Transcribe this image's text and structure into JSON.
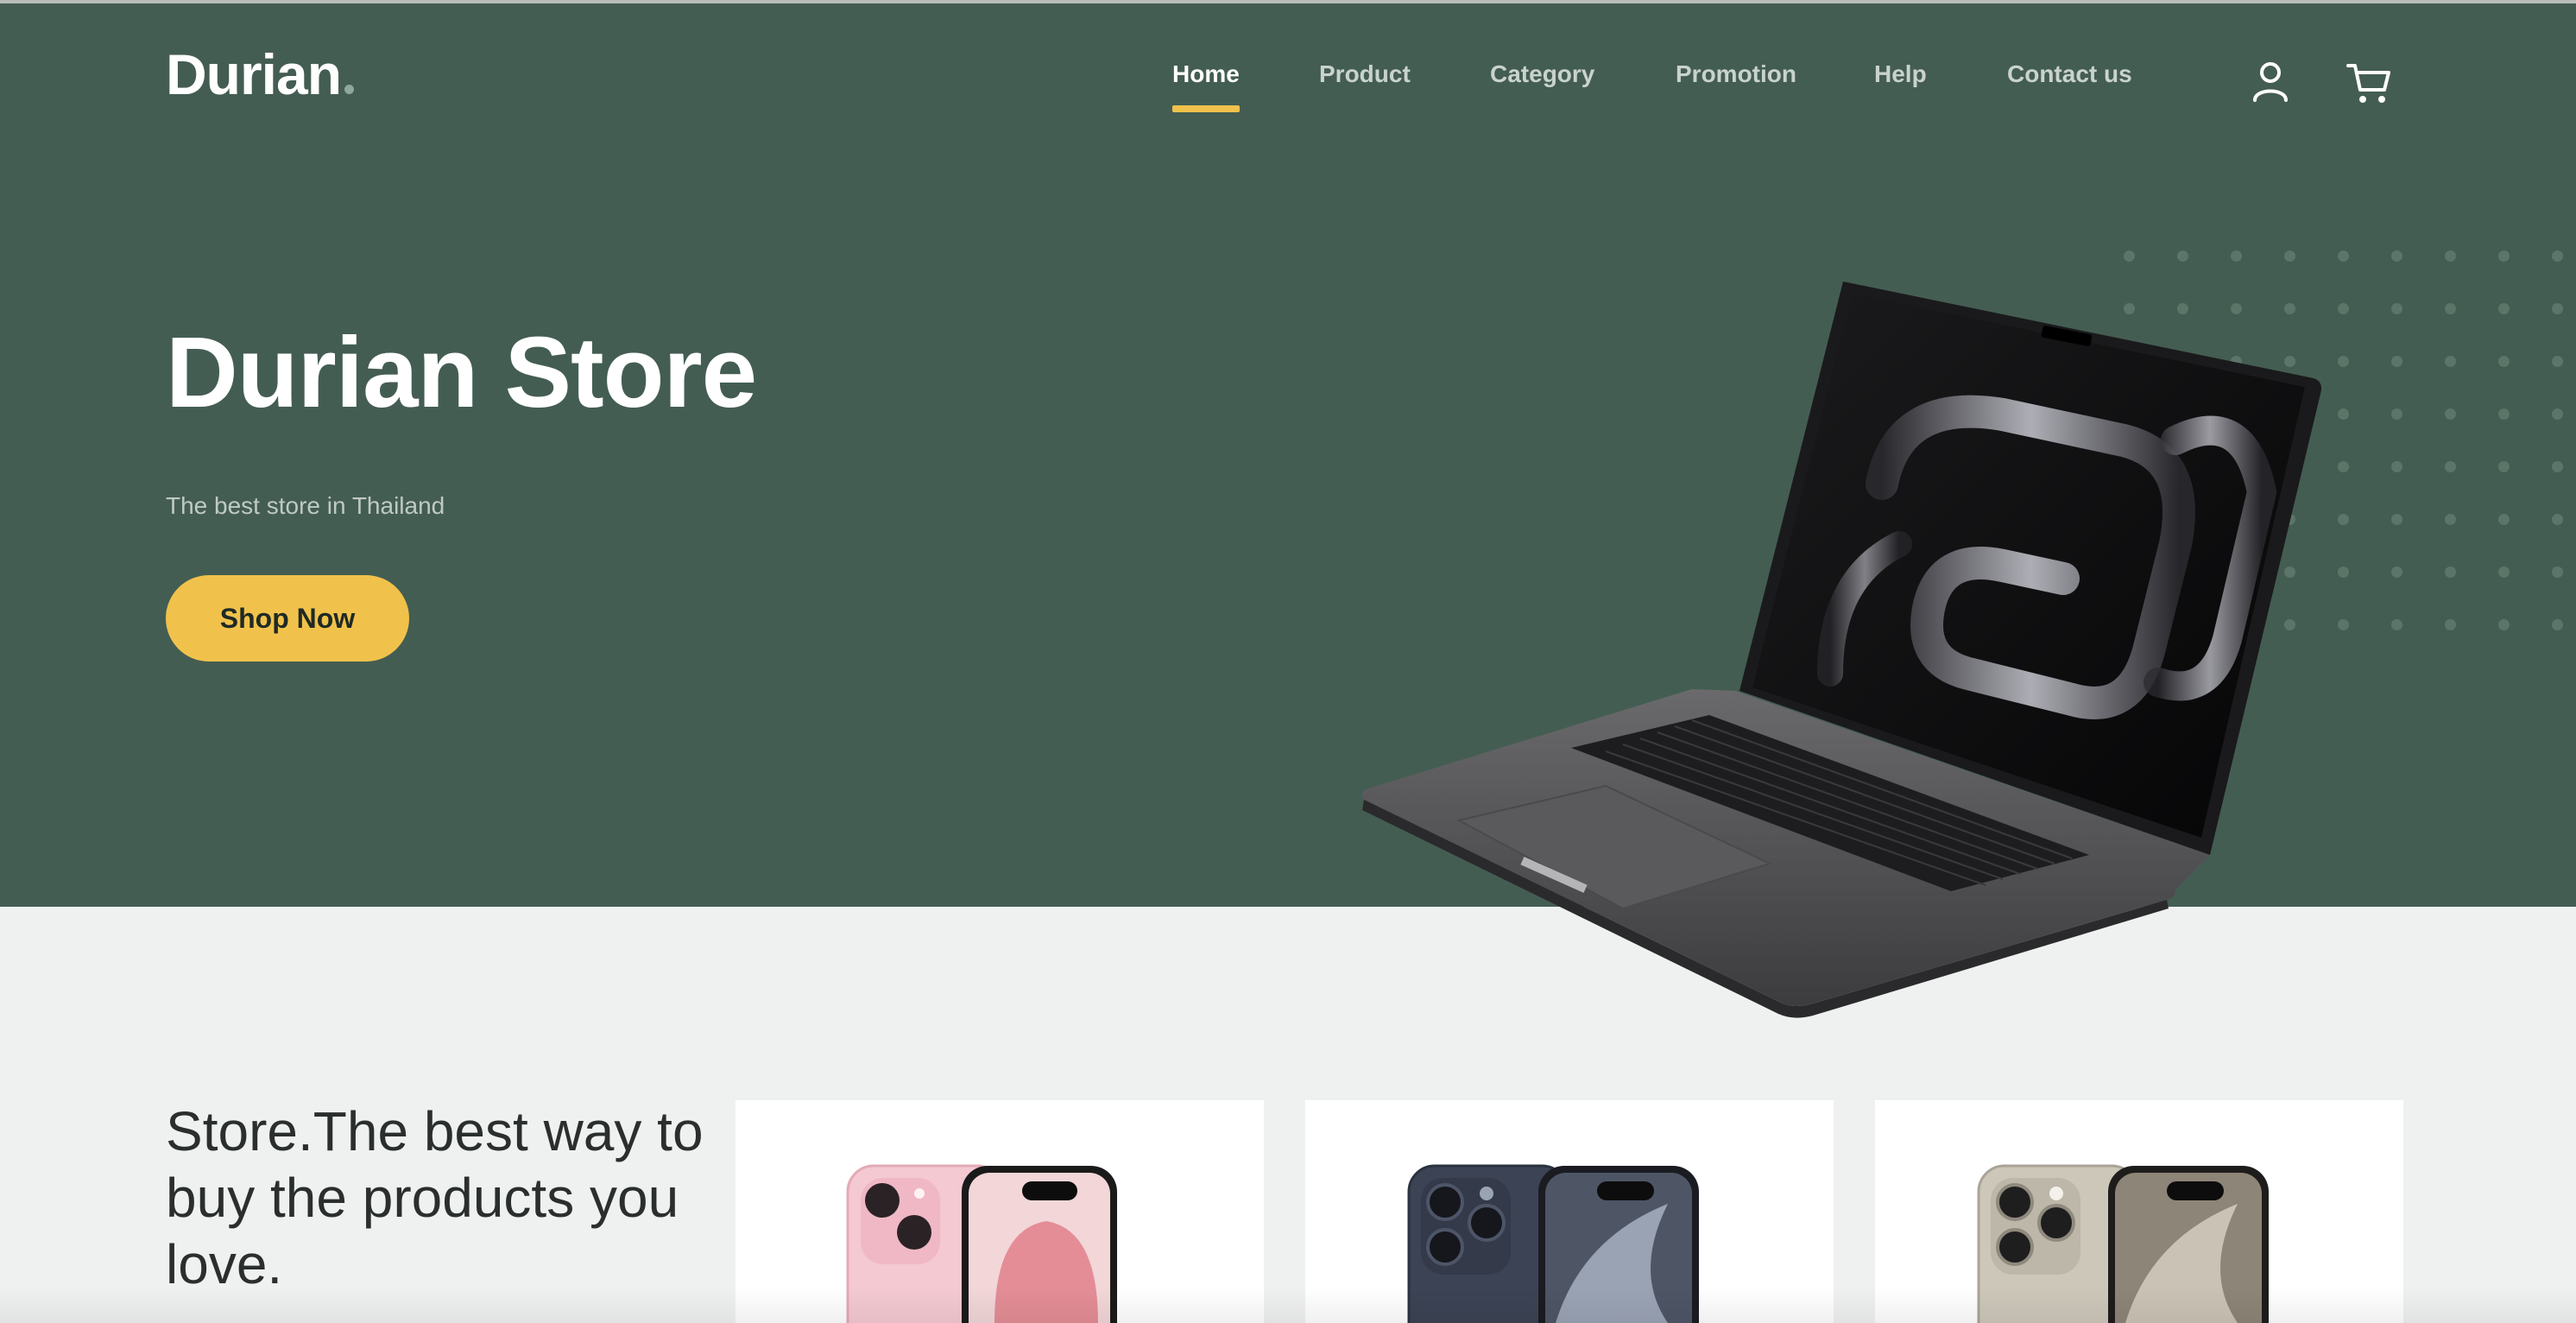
{
  "brand": {
    "name": "Durian",
    "accent": "#f1c24b",
    "hero_bg": "#445d52"
  },
  "nav": {
    "items": [
      {
        "label": "Home",
        "active": true
      },
      {
        "label": "Product",
        "active": false
      },
      {
        "label": "Category",
        "active": false
      },
      {
        "label": "Promotion",
        "active": false
      },
      {
        "label": "Help",
        "active": false
      },
      {
        "label": "Contact us",
        "active": false
      }
    ],
    "icons": [
      "user-icon",
      "cart-icon"
    ]
  },
  "hero": {
    "title": "Durian Store",
    "subtitle": "The best store in Thailand",
    "cta_label": "Shop Now",
    "image": "laptop-image"
  },
  "section": {
    "title": "Store.The best way to buy the products you love.",
    "cards": [
      {
        "image": "pink-phone-image",
        "color": "#f3c6cf"
      },
      {
        "image": "blue-titanium-phone-image",
        "color": "#3f4656"
      },
      {
        "image": "natural-titanium-phone-image",
        "color": "#c9c3b6"
      }
    ]
  }
}
